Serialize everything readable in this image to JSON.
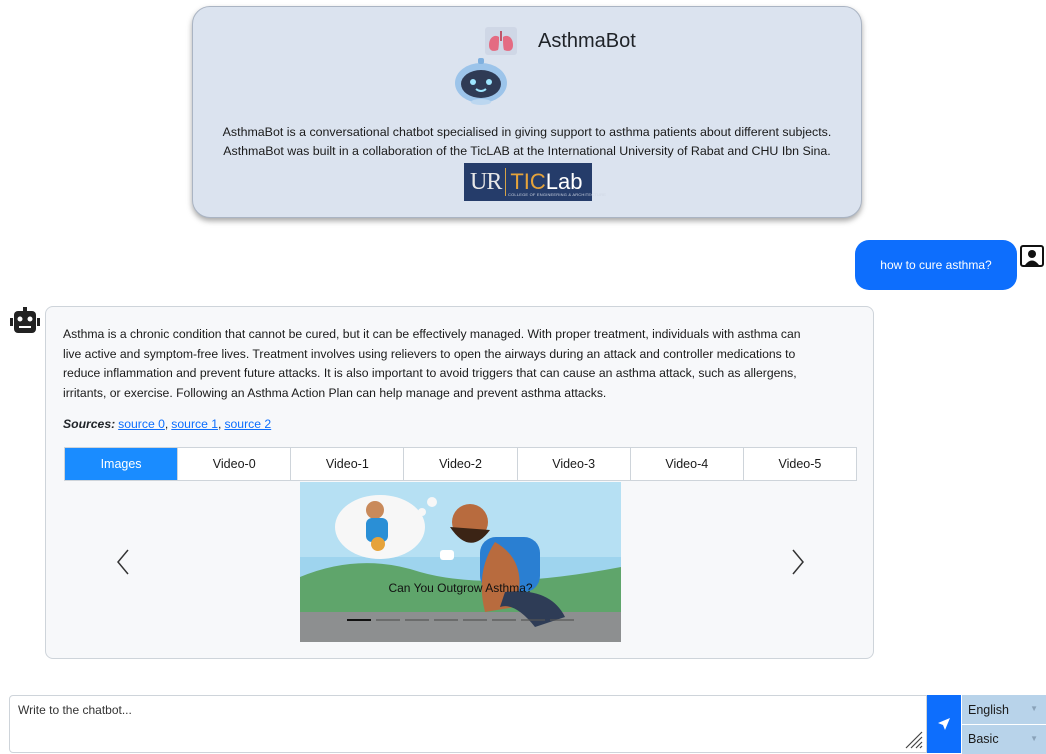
{
  "intro": {
    "bot_name": "AsthmaBot",
    "description_lines": [
      "AsthmaBot is a conversational chatbot specialised in giving support to asthma patients about different subjects.",
      "AsthmaBot was built in a collaboration of the TicLAB at the International University of Rabat and CHU Ibn Sina."
    ],
    "logo": {
      "ur": "UR",
      "tic": "TIC",
      "lab": "Lab",
      "subtitle": "COLLEGE OF ENGINEERING & ARCHITECTURE"
    }
  },
  "user_message": {
    "text": "how to cure asthma?"
  },
  "bot_message": {
    "answer_lines": [
      "Asthma is a chronic condition that cannot be cured, but it can be effectively managed. With proper treatment, individuals with asthma can",
      "live active and symptom-free lives. Treatment involves using relievers to open the airways during an attack and controller medications to",
      "reduce inflammation and prevent future attacks. It is also important to avoid triggers that can cause an asthma attack, such as allergens,",
      "irritants, or exercise. Following an Asthma Action Plan can help manage and prevent asthma attacks."
    ],
    "sources_label": "Sources:",
    "sources": [
      "source 0",
      "source 1",
      "source 2"
    ],
    "tabs": [
      "Images",
      "Video-0",
      "Video-1",
      "Video-2",
      "Video-3",
      "Video-4",
      "Video-5"
    ],
    "active_tab": "Images",
    "carousel": {
      "caption": "Can You Outgrow Asthma?",
      "slide_count": 8,
      "active_slide": 1
    }
  },
  "input": {
    "placeholder": "Write to the chatbot...",
    "value": ""
  },
  "language_select": {
    "value": "English"
  },
  "mode_select": {
    "value": "Basic"
  },
  "colors": {
    "accent": "#0d6efd",
    "intro_bg": "#dbe3ef",
    "select_bg": "#b8d3ea",
    "tab_active": "#1a8cff"
  }
}
